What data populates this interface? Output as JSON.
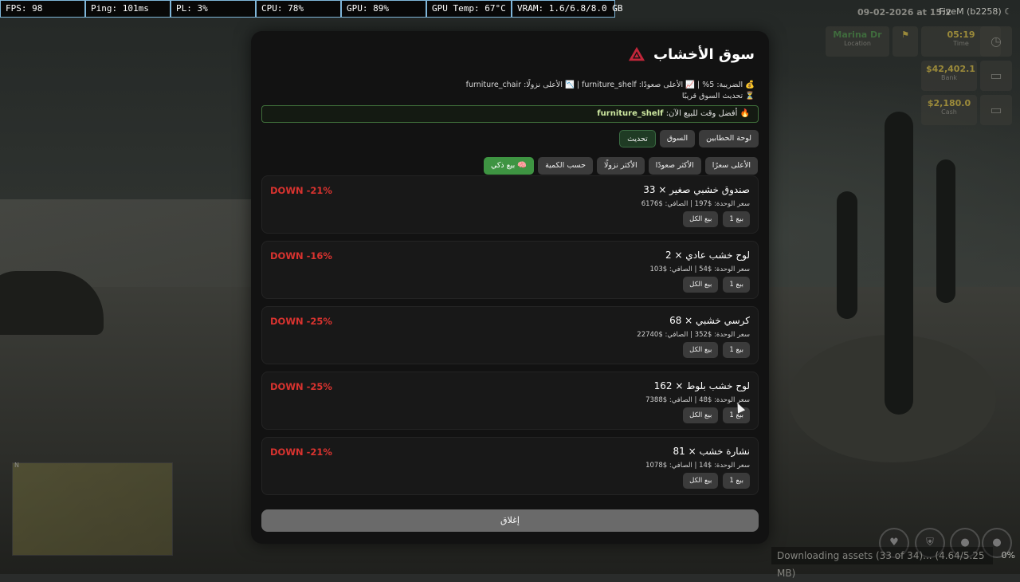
{
  "perf": {
    "fps": "FPS: 98",
    "ping": "Ping: 101ms",
    "pl": "PL: 3%",
    "cpu": "CPU: 78%",
    "gpu": "GPU: 89%",
    "gpu_temp": "GPU Temp: 67°C",
    "vram": "VRAM: 1.6/6.8/8.0 GB"
  },
  "hud": {
    "datetime": "09-02-2026 at 15:2",
    "fivem": "FiveM (b2258)",
    "location_value": "Marina Dr",
    "location_label": "Location",
    "time_value": "05:19",
    "time_label": "Time",
    "bank_value": "$42,402.1",
    "bank_label": "Bank",
    "cash_value": "$2,180.0",
    "cash_label": "Cash",
    "download": "Downloading assets (33 of 34)... (4.64/5.25 MB)",
    "download_pct": "0%",
    "map_north": "N"
  },
  "market": {
    "title": "سوق الأخشاب",
    "tax_line": "💰 الضريبة: 5% | 📈 الأعلى صعودًا: furniture_shelf | 📉 الأعلى نزولًا: furniture_chair",
    "refresh_note": "⏳ تحديث السوق قريبًا",
    "best_prefix": "🔥 أفضل وقت للبيع الآن:",
    "best_item": "furniture_shelf",
    "nav": {
      "lumberjacks": "لوحة الحطابين",
      "market": "السوق",
      "refresh": "تحديث"
    },
    "filters": {
      "highest_price": "الأعلى سعرًا",
      "most_rising": "الأكثر صعودًا",
      "most_falling": "الأكثر نزولًا",
      "by_quantity": "حسب الكمية",
      "smart_sell": "🧠 بيع ذكي"
    },
    "items": [
      {
        "name": "صندوق خشبي صغير × 33",
        "price": "سعر الوحدة: $197 | الصافي: $6176",
        "trend": "DOWN -21%",
        "sell_one": "بيع 1",
        "sell_all": "بيع الكل"
      },
      {
        "name": "لوح خشب عادي × 2",
        "price": "سعر الوحدة: $54 | الصافي: $103",
        "trend": "DOWN -16%",
        "sell_one": "بيع 1",
        "sell_all": "بيع الكل"
      },
      {
        "name": "كرسي خشبي × 68",
        "price": "سعر الوحدة: $352 | الصافي: $22740",
        "trend": "DOWN -25%",
        "sell_one": "بيع 1",
        "sell_all": "بيع الكل"
      },
      {
        "name": "لوح خشب بلوط × 162",
        "price": "سعر الوحدة: $48 | الصافي: $7388",
        "trend": "DOWN -25%",
        "sell_one": "بيع 1",
        "sell_all": "بيع الكل"
      },
      {
        "name": "نشارة خشب × 81",
        "price": "سعر الوحدة: $14 | الصافي: $1078",
        "trend": "DOWN -21%",
        "sell_one": "بيع 1",
        "sell_all": "بيع الكل"
      }
    ],
    "close": "إغلاق"
  },
  "colors": {
    "trend_down": "#d9332f",
    "smart_sell": "#3e9442",
    "panel_bg": "#121212"
  }
}
